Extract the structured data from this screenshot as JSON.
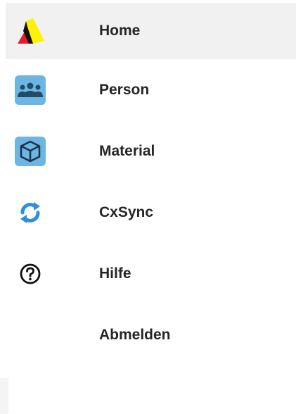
{
  "menu": {
    "items": [
      {
        "label": "Home",
        "icon": "company-logo-icon",
        "active": true
      },
      {
        "label": "Person",
        "icon": "people-group-icon",
        "active": false
      },
      {
        "label": "Material",
        "icon": "cube-icon",
        "active": false
      },
      {
        "label": "CxSync",
        "icon": "sync-icon",
        "active": false
      },
      {
        "label": "Hilfe",
        "icon": "help-circle-icon",
        "active": false
      },
      {
        "label": "Abmelden",
        "icon": "",
        "active": false
      }
    ]
  },
  "colors": {
    "active_background": "#f1f1f1",
    "label_text": "#262626",
    "icon_tile": "#6cb6e3",
    "icon_tile_glyph": "#234a66",
    "sync_blue": "#2f8ee0",
    "logo_red": "#e8192c",
    "logo_yellow": "#fff200"
  }
}
